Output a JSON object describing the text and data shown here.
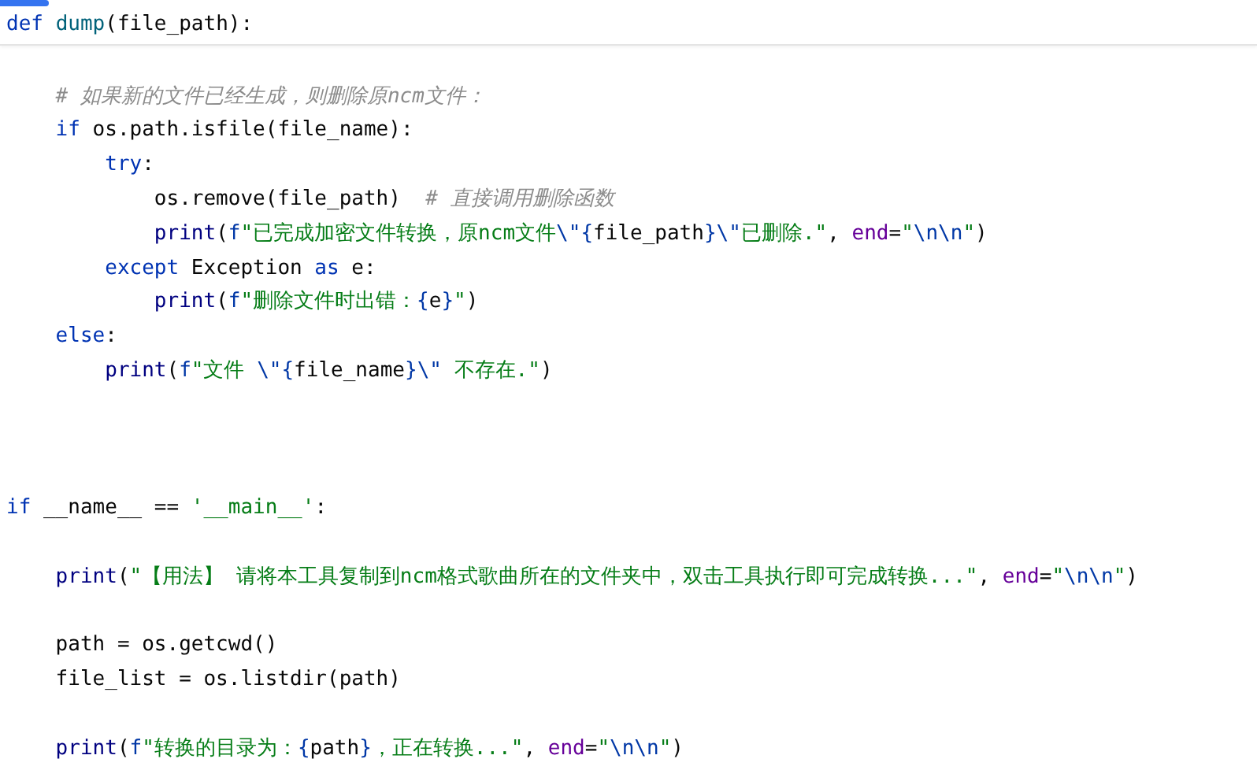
{
  "sticky_header": {
    "tokens": [
      {
        "text": "def ",
        "kind": "keyword"
      },
      {
        "text": "dump",
        "kind": "function"
      },
      {
        "text": "(file_path):",
        "kind": "plain"
      }
    ]
  },
  "lines": [
    {
      "kind": "blank"
    },
    {
      "kind": "code",
      "tokens": [
        {
          "text": "    # 如果新的文件已经生成，则删除原ncm文件：",
          "kind": "comment"
        }
      ]
    },
    {
      "kind": "code",
      "tokens": [
        {
          "text": "    if",
          "kind": "keyword"
        },
        {
          "text": " os.path.isfile(file_name):",
          "kind": "plain"
        }
      ]
    },
    {
      "kind": "code",
      "tokens": [
        {
          "text": "        try",
          "kind": "keyword"
        },
        {
          "text": ":",
          "kind": "plain"
        }
      ]
    },
    {
      "kind": "code",
      "tokens": [
        {
          "text": "            os.remove(file_path)  ",
          "kind": "plain"
        },
        {
          "text": "# 直接调用删除函数",
          "kind": "comment"
        }
      ]
    },
    {
      "kind": "code",
      "tokens": [
        {
          "text": "            print",
          "kind": "builtin"
        },
        {
          "text": "(",
          "kind": "plain"
        },
        {
          "text": "f",
          "kind": "escape"
        },
        {
          "text": "\"已完成加密文件转换，原ncm文件",
          "kind": "string"
        },
        {
          "text": "\\\"",
          "kind": "escape"
        },
        {
          "text": "{",
          "kind": "escape"
        },
        {
          "text": "file_path",
          "kind": "plain"
        },
        {
          "text": "}",
          "kind": "escape"
        },
        {
          "text": "\\\"",
          "kind": "escape"
        },
        {
          "text": "已删除.\"",
          "kind": "string"
        },
        {
          "text": ", ",
          "kind": "plain"
        },
        {
          "text": "end",
          "kind": "kwarg"
        },
        {
          "text": "=",
          "kind": "plain"
        },
        {
          "text": "\"",
          "kind": "string"
        },
        {
          "text": "\\n\\n",
          "kind": "escape"
        },
        {
          "text": "\"",
          "kind": "string"
        },
        {
          "text": ")",
          "kind": "plain"
        }
      ]
    },
    {
      "kind": "code",
      "tokens": [
        {
          "text": "        except",
          "kind": "keyword"
        },
        {
          "text": " Exception ",
          "kind": "plain"
        },
        {
          "text": "as",
          "kind": "keyword"
        },
        {
          "text": " e:",
          "kind": "plain"
        }
      ]
    },
    {
      "kind": "code",
      "tokens": [
        {
          "text": "            print",
          "kind": "builtin"
        },
        {
          "text": "(",
          "kind": "plain"
        },
        {
          "text": "f",
          "kind": "escape"
        },
        {
          "text": "\"删除文件时出错：",
          "kind": "string"
        },
        {
          "text": "{",
          "kind": "escape"
        },
        {
          "text": "e",
          "kind": "plain"
        },
        {
          "text": "}",
          "kind": "escape"
        },
        {
          "text": "\"",
          "kind": "string"
        },
        {
          "text": ")",
          "kind": "plain"
        }
      ]
    },
    {
      "kind": "code",
      "tokens": [
        {
          "text": "    else",
          "kind": "keyword"
        },
        {
          "text": ":",
          "kind": "plain"
        }
      ]
    },
    {
      "kind": "code",
      "tokens": [
        {
          "text": "        print",
          "kind": "builtin"
        },
        {
          "text": "(",
          "kind": "plain"
        },
        {
          "text": "f",
          "kind": "escape"
        },
        {
          "text": "\"文件 ",
          "kind": "string"
        },
        {
          "text": "\\\"",
          "kind": "escape"
        },
        {
          "text": "{",
          "kind": "escape"
        },
        {
          "text": "file_name",
          "kind": "plain"
        },
        {
          "text": "}",
          "kind": "escape"
        },
        {
          "text": "\\\"",
          "kind": "escape"
        },
        {
          "text": " 不存在.\"",
          "kind": "string"
        },
        {
          "text": ")",
          "kind": "plain"
        }
      ]
    },
    {
      "kind": "blank"
    },
    {
      "kind": "blank"
    },
    {
      "kind": "blank"
    },
    {
      "kind": "code",
      "tokens": [
        {
          "text": "if",
          "kind": "keyword"
        },
        {
          "text": " __name__ == ",
          "kind": "plain"
        },
        {
          "text": "'__main__'",
          "kind": "string"
        },
        {
          "text": ":",
          "kind": "plain"
        }
      ]
    },
    {
      "kind": "blank"
    },
    {
      "kind": "code",
      "tokens": [
        {
          "text": "    print",
          "kind": "builtin"
        },
        {
          "text": "(",
          "kind": "plain"
        },
        {
          "text": "\"【用法】 请将本工具复制到ncm格式歌曲所在的文件夹中，双击工具执行即可完成转换...\"",
          "kind": "string"
        },
        {
          "text": ", ",
          "kind": "plain"
        },
        {
          "text": "end",
          "kind": "kwarg"
        },
        {
          "text": "=",
          "kind": "plain"
        },
        {
          "text": "\"",
          "kind": "string"
        },
        {
          "text": "\\n\\n",
          "kind": "escape"
        },
        {
          "text": "\"",
          "kind": "string"
        },
        {
          "text": ")",
          "kind": "plain"
        }
      ]
    },
    {
      "kind": "blank"
    },
    {
      "kind": "code",
      "tokens": [
        {
          "text": "    path = os.getcwd()",
          "kind": "plain"
        }
      ]
    },
    {
      "kind": "code",
      "tokens": [
        {
          "text": "    file_list = os.listdir(path)",
          "kind": "plain"
        }
      ]
    },
    {
      "kind": "blank"
    },
    {
      "kind": "code",
      "tokens": [
        {
          "text": "    print",
          "kind": "builtin"
        },
        {
          "text": "(",
          "kind": "plain"
        },
        {
          "text": "f",
          "kind": "escape"
        },
        {
          "text": "\"转换的目录为：",
          "kind": "string"
        },
        {
          "text": "{",
          "kind": "escape"
        },
        {
          "text": "path",
          "kind": "plain"
        },
        {
          "text": "}",
          "kind": "escape"
        },
        {
          "text": "，正在转换...\"",
          "kind": "string"
        },
        {
          "text": ", ",
          "kind": "plain"
        },
        {
          "text": "end",
          "kind": "kwarg"
        },
        {
          "text": "=",
          "kind": "plain"
        },
        {
          "text": "\"",
          "kind": "string"
        },
        {
          "text": "\\n\\n",
          "kind": "escape"
        },
        {
          "text": "\"",
          "kind": "string"
        },
        {
          "text": ")",
          "kind": "plain"
        }
      ]
    }
  ]
}
